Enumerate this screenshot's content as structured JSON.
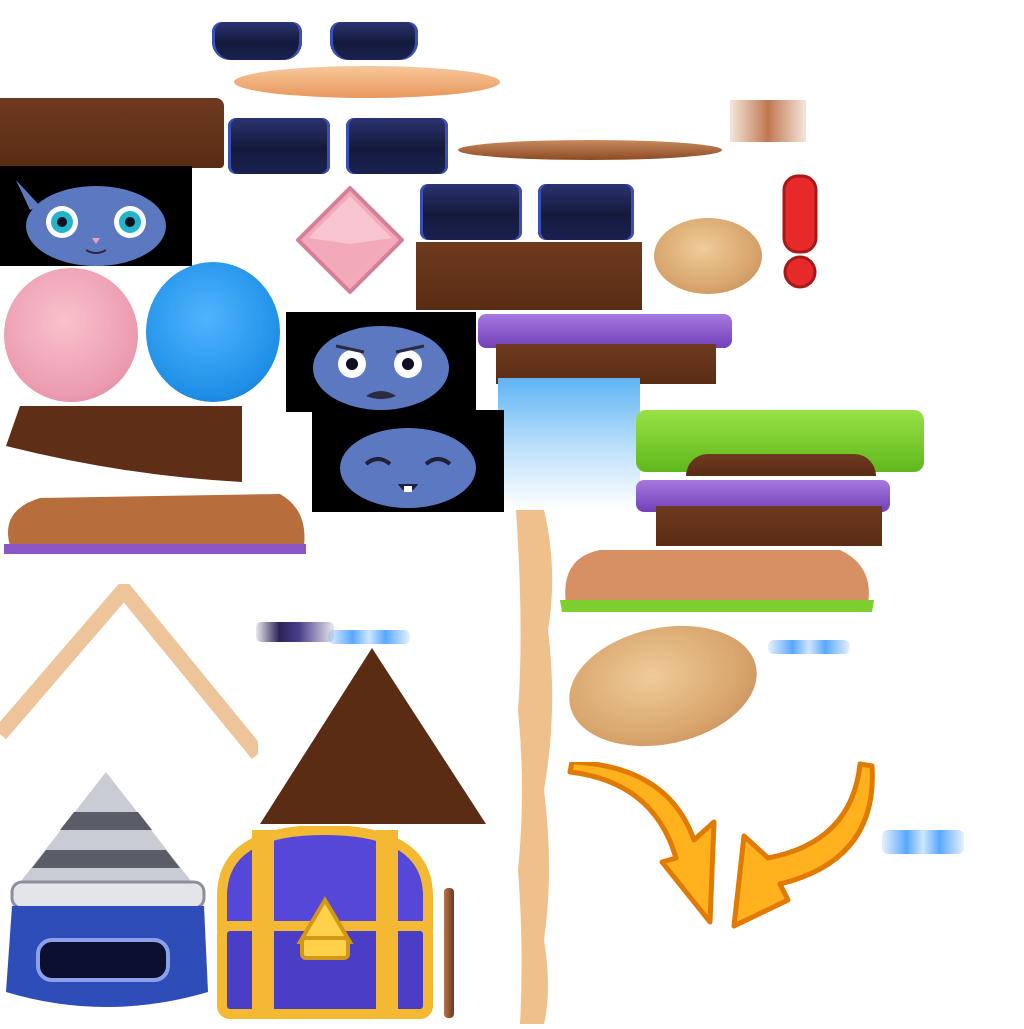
{
  "sheet": {
    "type": "sprite-atlas",
    "background": "#ffffff"
  },
  "colors": {
    "navy": "#1b2150",
    "navy_edge": "#3c4fb5",
    "brown": "#5e2f16",
    "peach": "#f0b07c",
    "pink": "#f2a9b9",
    "blue": "#1e8fe6",
    "purple": "#8a56c8",
    "green": "#7ccf2c",
    "orange": "#ffb21e",
    "orange_edge": "#e07a00",
    "red": "#e62a2a",
    "cat_fur": "#5c78c0",
    "chest_purple": "#5547d8",
    "chest_gold": "#f4b933",
    "helmet_silver": "#c9ccd4",
    "helmet_blue": "#2f4db8"
  },
  "cat_faces": [
    "neutral",
    "scared",
    "happy"
  ],
  "icons": {
    "exclamation": "exclamation-icon",
    "arrow_left": "curved-arrow-down-right-icon",
    "arrow_right": "curved-arrow-down-left-icon",
    "diamond": "diamond-gem-icon",
    "chest": "treasure-chest-icon",
    "helmet": "drill-helmet-icon"
  }
}
